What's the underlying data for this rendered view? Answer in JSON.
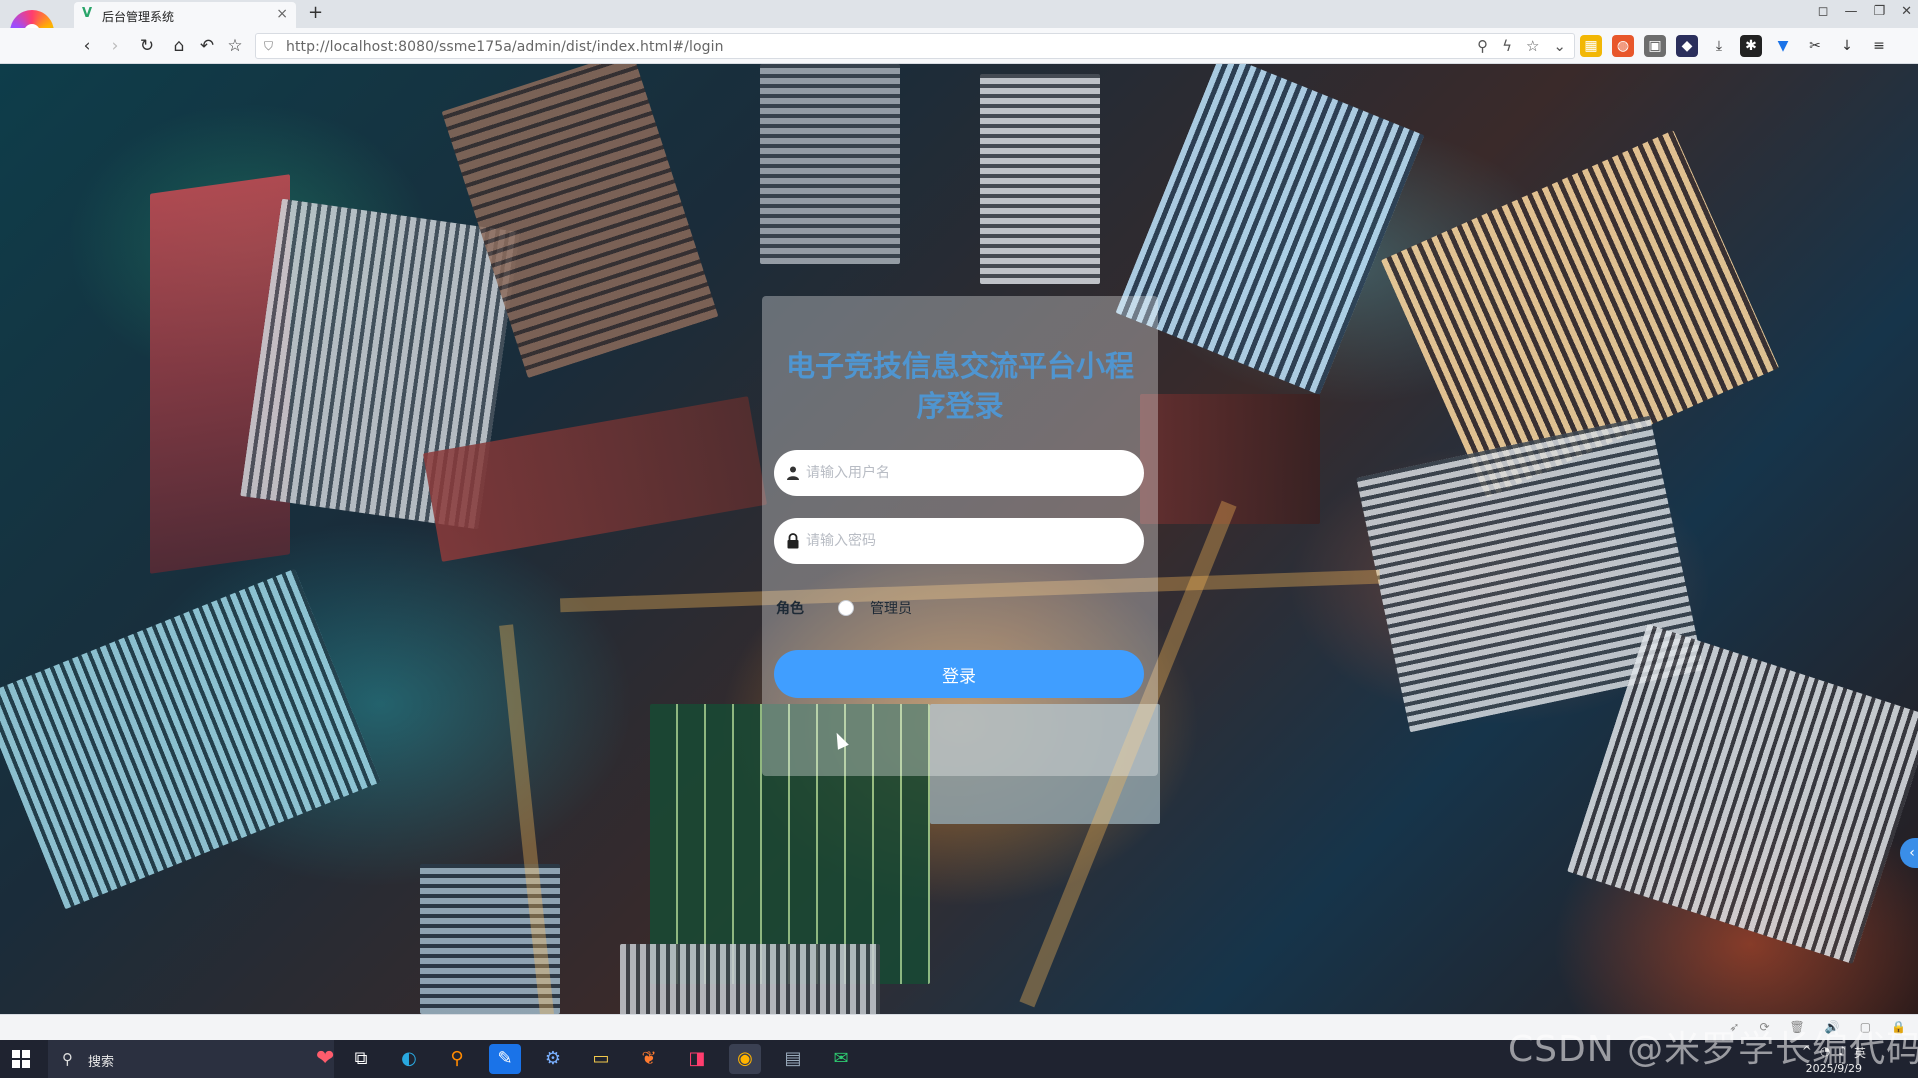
{
  "browser": {
    "tab_title": "后台管理系统",
    "tab_close": "×",
    "new_tab": "+",
    "url": "http://localhost:8080/ssme175a/admin/dist/index.html#/login"
  },
  "login": {
    "title": "电子竞技信息交流平台小程序登录",
    "username_placeholder": "请输入用户名",
    "password_placeholder": "请输入密码",
    "role_label": "角色",
    "role_option": "管理员",
    "submit_label": "登录"
  },
  "taskbar": {
    "search_label": "搜索",
    "watermark": "CSDN @米罗学长编代码",
    "date": "2025/9/29"
  },
  "icons": {
    "back": "back-icon",
    "forward": "forward-icon",
    "reload": "reload-icon",
    "home": "home-icon",
    "undo": "undo-icon",
    "bookmark": "star-icon",
    "user": "user-icon",
    "lock": "lock-icon"
  },
  "colors": {
    "accent": "#409eff",
    "title": "#46a0eb"
  }
}
